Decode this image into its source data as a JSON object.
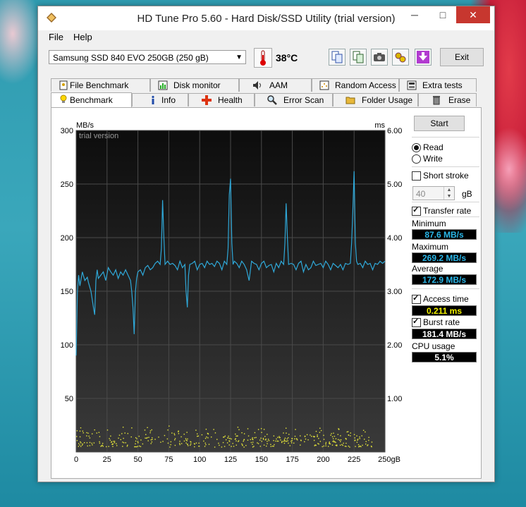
{
  "window": {
    "title": "HD Tune Pro 5.60 - Hard Disk/SSD Utility (trial version)",
    "controls": [
      "─",
      "□",
      "✕"
    ]
  },
  "menu": {
    "file": "File",
    "help": "Help"
  },
  "toolbar": {
    "drive": "Samsung SSD 840 EVO 250GB (250 gB)",
    "temperature": "38°C",
    "exit_label": "Exit"
  },
  "tabs": {
    "row1": [
      "File Benchmark",
      "Disk monitor",
      "AAM",
      "Random Access",
      "Extra tests"
    ],
    "row2": [
      "Benchmark",
      "Info",
      "Health",
      "Error Scan",
      "Folder Usage",
      "Erase"
    ],
    "active": "Benchmark"
  },
  "colors": {
    "transfer_line": "#2fa8d8",
    "access_dots": "#e8e83a",
    "plot_bg_top": "#0d0d0d",
    "plot_bg_bottom": "#3a3a3a"
  },
  "chart_data": {
    "type": "line",
    "watermark": "trial version",
    "left_unit": "MB/s",
    "right_unit": "ms",
    "x_unit": "gB",
    "xlim": [
      0,
      250
    ],
    "ylim_left": [
      0,
      300
    ],
    "ylim_right": [
      0,
      6
    ],
    "x_ticks": [
      "0",
      "25",
      "50",
      "75",
      "100",
      "125",
      "150",
      "175",
      "200",
      "225",
      "250gB"
    ],
    "y_ticks_left": [
      "300",
      "250",
      "200",
      "150",
      "100",
      "50"
    ],
    "y_ticks_right": [
      "6.00",
      "5.00",
      "4.00",
      "3.00",
      "2.00",
      "1.00"
    ],
    "grid": true,
    "series": [
      {
        "axis": "left",
        "x": [
          0,
          1,
          2,
          3,
          5,
          7,
          9,
          10,
          12,
          14,
          15,
          16,
          17,
          18,
          20,
          22,
          24,
          26,
          28,
          30,
          32,
          34,
          36,
          38,
          40,
          42,
          44,
          45,
          46,
          47,
          48,
          49,
          50,
          52,
          54,
          56,
          58,
          60,
          62,
          64,
          66,
          68,
          69,
          70,
          71,
          72,
          74,
          76,
          78,
          80,
          82,
          84,
          86,
          88,
          89,
          90,
          91,
          92,
          94,
          96,
          98,
          100,
          102,
          104,
          106,
          108,
          110,
          112,
          114,
          116,
          118,
          120,
          122,
          123,
          124,
          125,
          126,
          127,
          128,
          130,
          132,
          134,
          136,
          138,
          139,
          140,
          142,
          144,
          146,
          148,
          150,
          152,
          154,
          156,
          158,
          160,
          162,
          164,
          166,
          168,
          169,
          170,
          171,
          172,
          174,
          176,
          178,
          180,
          182,
          184,
          186,
          188,
          190,
          192,
          194,
          196,
          198,
          200,
          202,
          204,
          206,
          208,
          210,
          212,
          214,
          216,
          218,
          220,
          222,
          223,
          224,
          225,
          226,
          227,
          228,
          230,
          232,
          234,
          236,
          238,
          240,
          242,
          244,
          246,
          248,
          250
        ],
        "y": [
          90,
          150,
          165,
          155,
          168,
          160,
          163,
          158,
          150,
          135,
          128,
          160,
          170,
          162,
          165,
          168,
          160,
          172,
          168,
          165,
          170,
          162,
          168,
          165,
          170,
          165,
          160,
          150,
          135,
          110,
          150,
          162,
          168,
          170,
          165,
          172,
          174,
          170,
          172,
          176,
          178,
          175,
          190,
          235,
          200,
          175,
          178,
          175,
          176,
          174,
          170,
          178,
          172,
          175,
          150,
          135,
          165,
          175,
          176,
          178,
          170,
          175,
          176,
          172,
          178,
          175,
          176,
          173,
          178,
          176,
          170,
          178,
          175,
          190,
          240,
          255,
          195,
          175,
          178,
          176,
          172,
          178,
          175,
          170,
          165,
          160,
          178,
          176,
          175,
          170,
          176,
          178,
          172,
          174,
          175,
          168,
          176,
          172,
          178,
          175,
          195,
          232,
          200,
          175,
          176,
          175,
          170,
          176,
          178,
          168,
          175,
          170,
          172,
          178,
          174,
          175,
          176,
          172,
          178,
          175,
          170,
          176,
          174,
          172,
          175,
          170,
          176,
          175,
          176,
          195,
          225,
          262,
          195,
          178,
          175,
          176,
          172,
          178,
          175,
          176,
          170,
          176,
          175,
          178,
          176,
          178
        ]
      }
    ],
    "access_time_band_ms": [
      0.1,
      0.5
    ]
  },
  "controls": {
    "start": "Start",
    "read": "Read",
    "write": "Write",
    "short_stroke": "Short stroke",
    "short_stroke_value": "40",
    "gb": "gB",
    "transfer_rate": "Transfer rate",
    "minimum_label": "Minimum",
    "minimum": "87.6 MB/s",
    "maximum_label": "Maximum",
    "maximum": "269.2 MB/s",
    "average_label": "Average",
    "average": "172.9 MB/s",
    "access_time": "Access time",
    "access_time_value": "0.211 ms",
    "burst_rate": "Burst rate",
    "burst_rate_value": "181.4 MB/s",
    "cpu_usage_label": "CPU usage",
    "cpu_usage": "5.1%"
  }
}
